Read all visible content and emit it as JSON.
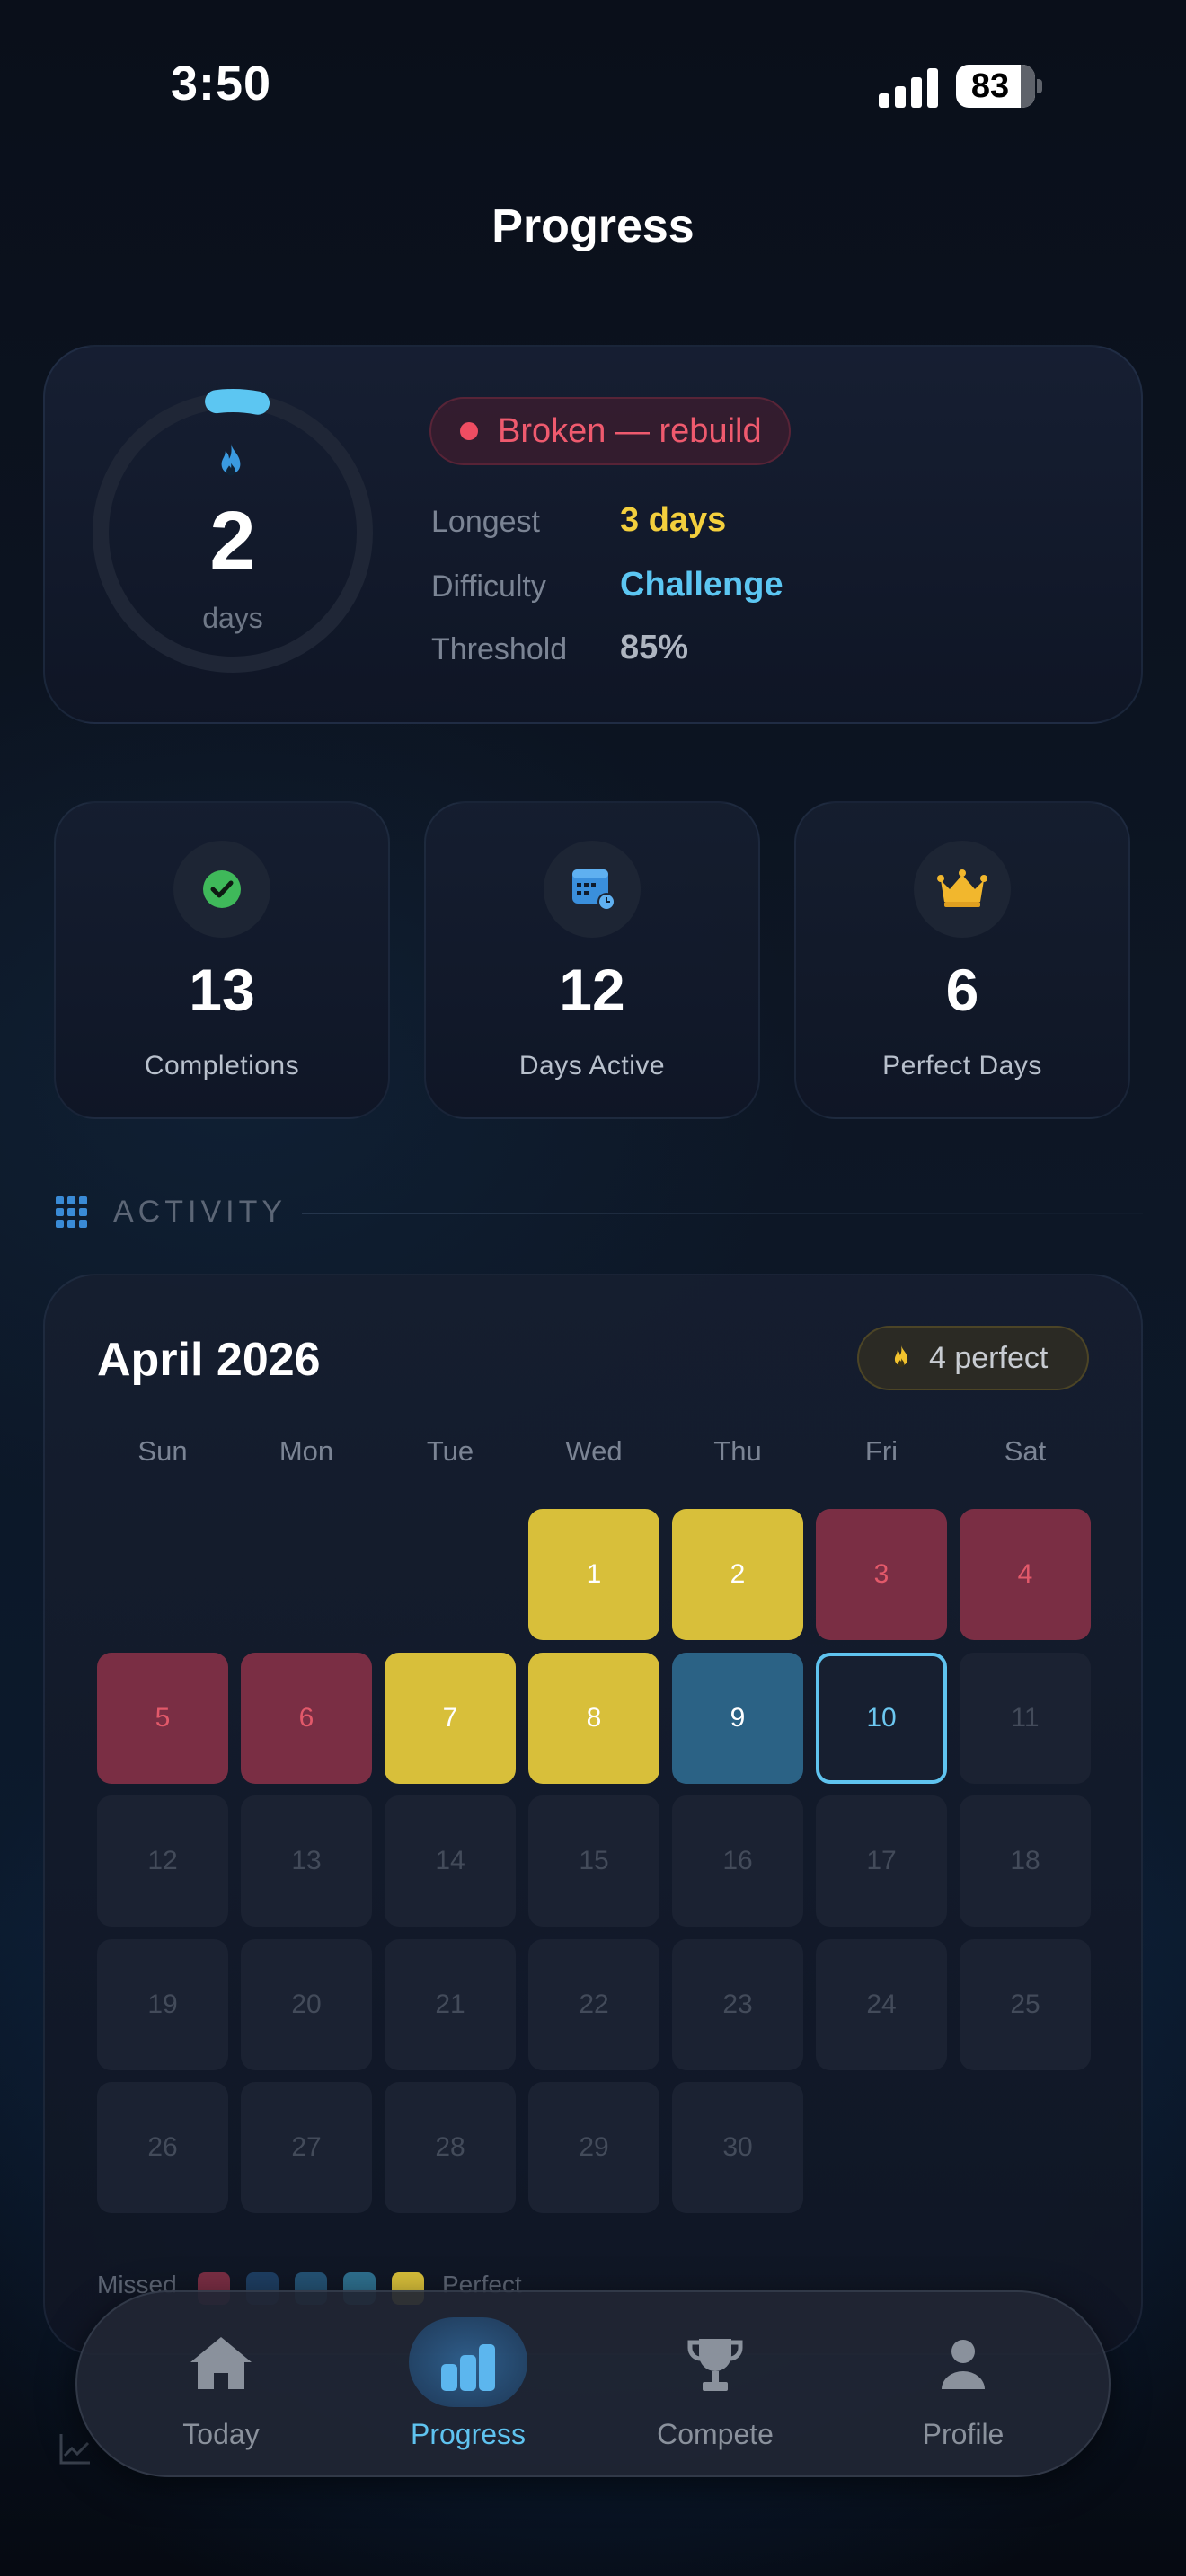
{
  "status_bar": {
    "time": "3:50",
    "battery": "83"
  },
  "header": {
    "title": "Progress"
  },
  "streak": {
    "value": "2",
    "unit": "days",
    "status": "Broken — rebuild",
    "ring_progress": 0.05,
    "stats": [
      {
        "label": "Longest",
        "value": "3 days",
        "color": "#f3cf3d"
      },
      {
        "label": "Difficulty",
        "value": "Challenge",
        "color": "#5cc6f2"
      },
      {
        "label": "Threshold",
        "value": "85%",
        "color": "#aeb5c0"
      }
    ]
  },
  "summary_cards": [
    {
      "icon": "check-circle-icon",
      "value": "13",
      "label": "Completions"
    },
    {
      "icon": "calendar-icon",
      "value": "12",
      "label": "Days Active"
    },
    {
      "icon": "crown-icon",
      "value": "6",
      "label": "Perfect Days"
    }
  ],
  "activity": {
    "section_title": "ACTIVITY",
    "month": "April 2026",
    "perfect_badge": "4 perfect",
    "weekdays": [
      "Sun",
      "Mon",
      "Tue",
      "Wed",
      "Thu",
      "Fri",
      "Sat"
    ],
    "days": [
      {
        "d": "1",
        "s": "perfect"
      },
      {
        "d": "2",
        "s": "perfect"
      },
      {
        "d": "3",
        "s": "missed"
      },
      {
        "d": "4",
        "s": "missed"
      },
      {
        "d": "5",
        "s": "missed"
      },
      {
        "d": "6",
        "s": "missed"
      },
      {
        "d": "7",
        "s": "perfect"
      },
      {
        "d": "8",
        "s": "perfect"
      },
      {
        "d": "9",
        "s": "partial"
      },
      {
        "d": "10",
        "s": "today"
      },
      {
        "d": "11",
        "s": "future"
      },
      {
        "d": "12",
        "s": "future"
      },
      {
        "d": "13",
        "s": "future"
      },
      {
        "d": "14",
        "s": "future"
      },
      {
        "d": "15",
        "s": "future"
      },
      {
        "d": "16",
        "s": "future"
      },
      {
        "d": "17",
        "s": "future"
      },
      {
        "d": "18",
        "s": "future"
      },
      {
        "d": "19",
        "s": "future"
      },
      {
        "d": "20",
        "s": "future"
      },
      {
        "d": "21",
        "s": "future"
      },
      {
        "d": "22",
        "s": "future"
      },
      {
        "d": "23",
        "s": "future"
      },
      {
        "d": "24",
        "s": "future"
      },
      {
        "d": "25",
        "s": "future"
      },
      {
        "d": "26",
        "s": "future"
      },
      {
        "d": "27",
        "s": "future"
      },
      {
        "d": "28",
        "s": "future"
      },
      {
        "d": "29",
        "s": "future"
      },
      {
        "d": "30",
        "s": "future"
      }
    ],
    "legend": {
      "low_label": "Missed",
      "high_label": "Perfect",
      "colors": [
        "#7a2e44",
        "#1e3e62",
        "#245274",
        "#2e6f8e",
        "#d8bf3a"
      ]
    }
  },
  "nav": {
    "items": [
      {
        "label": "Today",
        "icon": "home-icon"
      },
      {
        "label": "Progress",
        "icon": "bar-chart-icon",
        "active": true
      },
      {
        "label": "Compete",
        "icon": "trophy-icon"
      },
      {
        "label": "Profile",
        "icon": "person-icon"
      }
    ]
  },
  "colors": {
    "accent": "#5fc3ef",
    "perfect": "#d8bf3a",
    "missed": "#7a2e44",
    "partial": "#2b6285",
    "broken": "#ef5a6e"
  }
}
